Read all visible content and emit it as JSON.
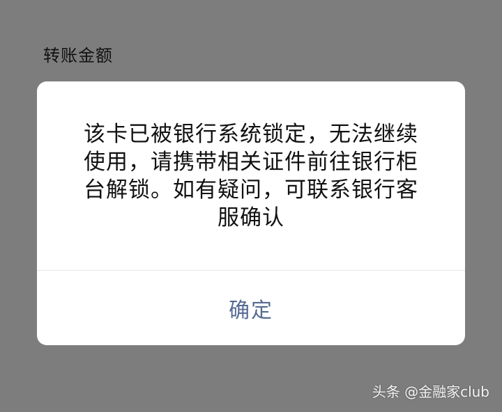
{
  "page": {
    "label": "转账金额"
  },
  "dialog": {
    "message": "该卡已被银行系统锁定，无法继续使用，请携带相关证件前往银行柜台解锁。如有疑问，可联系银行客服确认",
    "confirm_label": "确定"
  },
  "watermark": {
    "text": "头条 @金融家club"
  },
  "colors": {
    "overlay": "#7d7d7d",
    "dialog_background": "#ffffff",
    "confirm_text": "#566a92"
  }
}
